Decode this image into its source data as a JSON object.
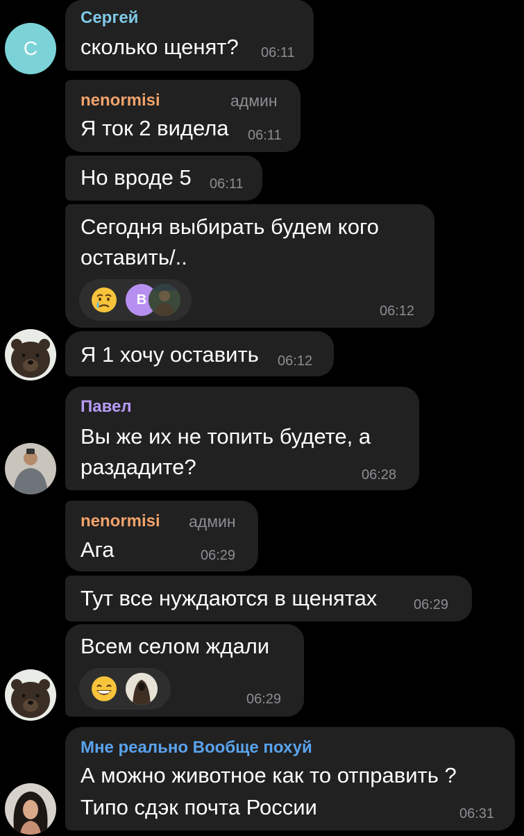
{
  "colors": {
    "background": "#000000",
    "bubble": "#212121",
    "reaction_pill": "#2e2e2e",
    "time_text": "#8d8d93",
    "sender_sergey": "#7fc8e6",
    "sender_nenormisi": "#f1a36b",
    "sender_pavel": "#b79af7",
    "sender_third": "#5aa3ee",
    "letter_avatar": "#7bd3d8",
    "reaction_avatar": "#b78ff0"
  },
  "messages": [
    {
      "sender": "Сергей",
      "text": "сколько щенят?",
      "time": "06:11",
      "avatar_letter": "С"
    },
    {
      "sender": "nenormisi",
      "role": "админ",
      "text": "Я ток 2 видела",
      "time": "06:11"
    },
    {
      "text": "Но вроде 5",
      "time": "06:11"
    },
    {
      "lines": [
        "Сегодня выбирать будем кого",
        "оставить/.."
      ],
      "time": "06:12",
      "reactions": [
        {
          "icon": "crying-face-icon"
        },
        {
          "avatar_letter": "В",
          "icon": "letter-avatar-icon"
        },
        {
          "icon": "user-photo-icon"
        }
      ]
    },
    {
      "text": "Я 1 хочу оставить",
      "time": "06:12",
      "avatar_icon": "bear-photo-icon"
    },
    {
      "sender": "Павел",
      "lines": [
        "Вы же их не топить будете, а",
        "раздадите?"
      ],
      "time": "06:28",
      "avatar_icon": "user-photo-icon"
    },
    {
      "sender": "nenormisi",
      "role": "админ",
      "text": "Ага",
      "time": "06:29"
    },
    {
      "text": "Тут все нуждаются в щенятах",
      "time": "06:29"
    },
    {
      "text": "Всем селом ждали",
      "time": "06:29",
      "avatar_icon": "bear-photo-icon",
      "reactions": [
        {
          "icon": "grinning-face-icon"
        },
        {
          "icon": "user-photo-icon"
        }
      ]
    },
    {
      "sender": "Мне реально Вообще похуй",
      "lines": [
        "А можно животное как то отправить ?",
        "Типо сдэк почта России"
      ],
      "time": "06:31",
      "avatar_icon": "user-photo-icon"
    }
  ]
}
